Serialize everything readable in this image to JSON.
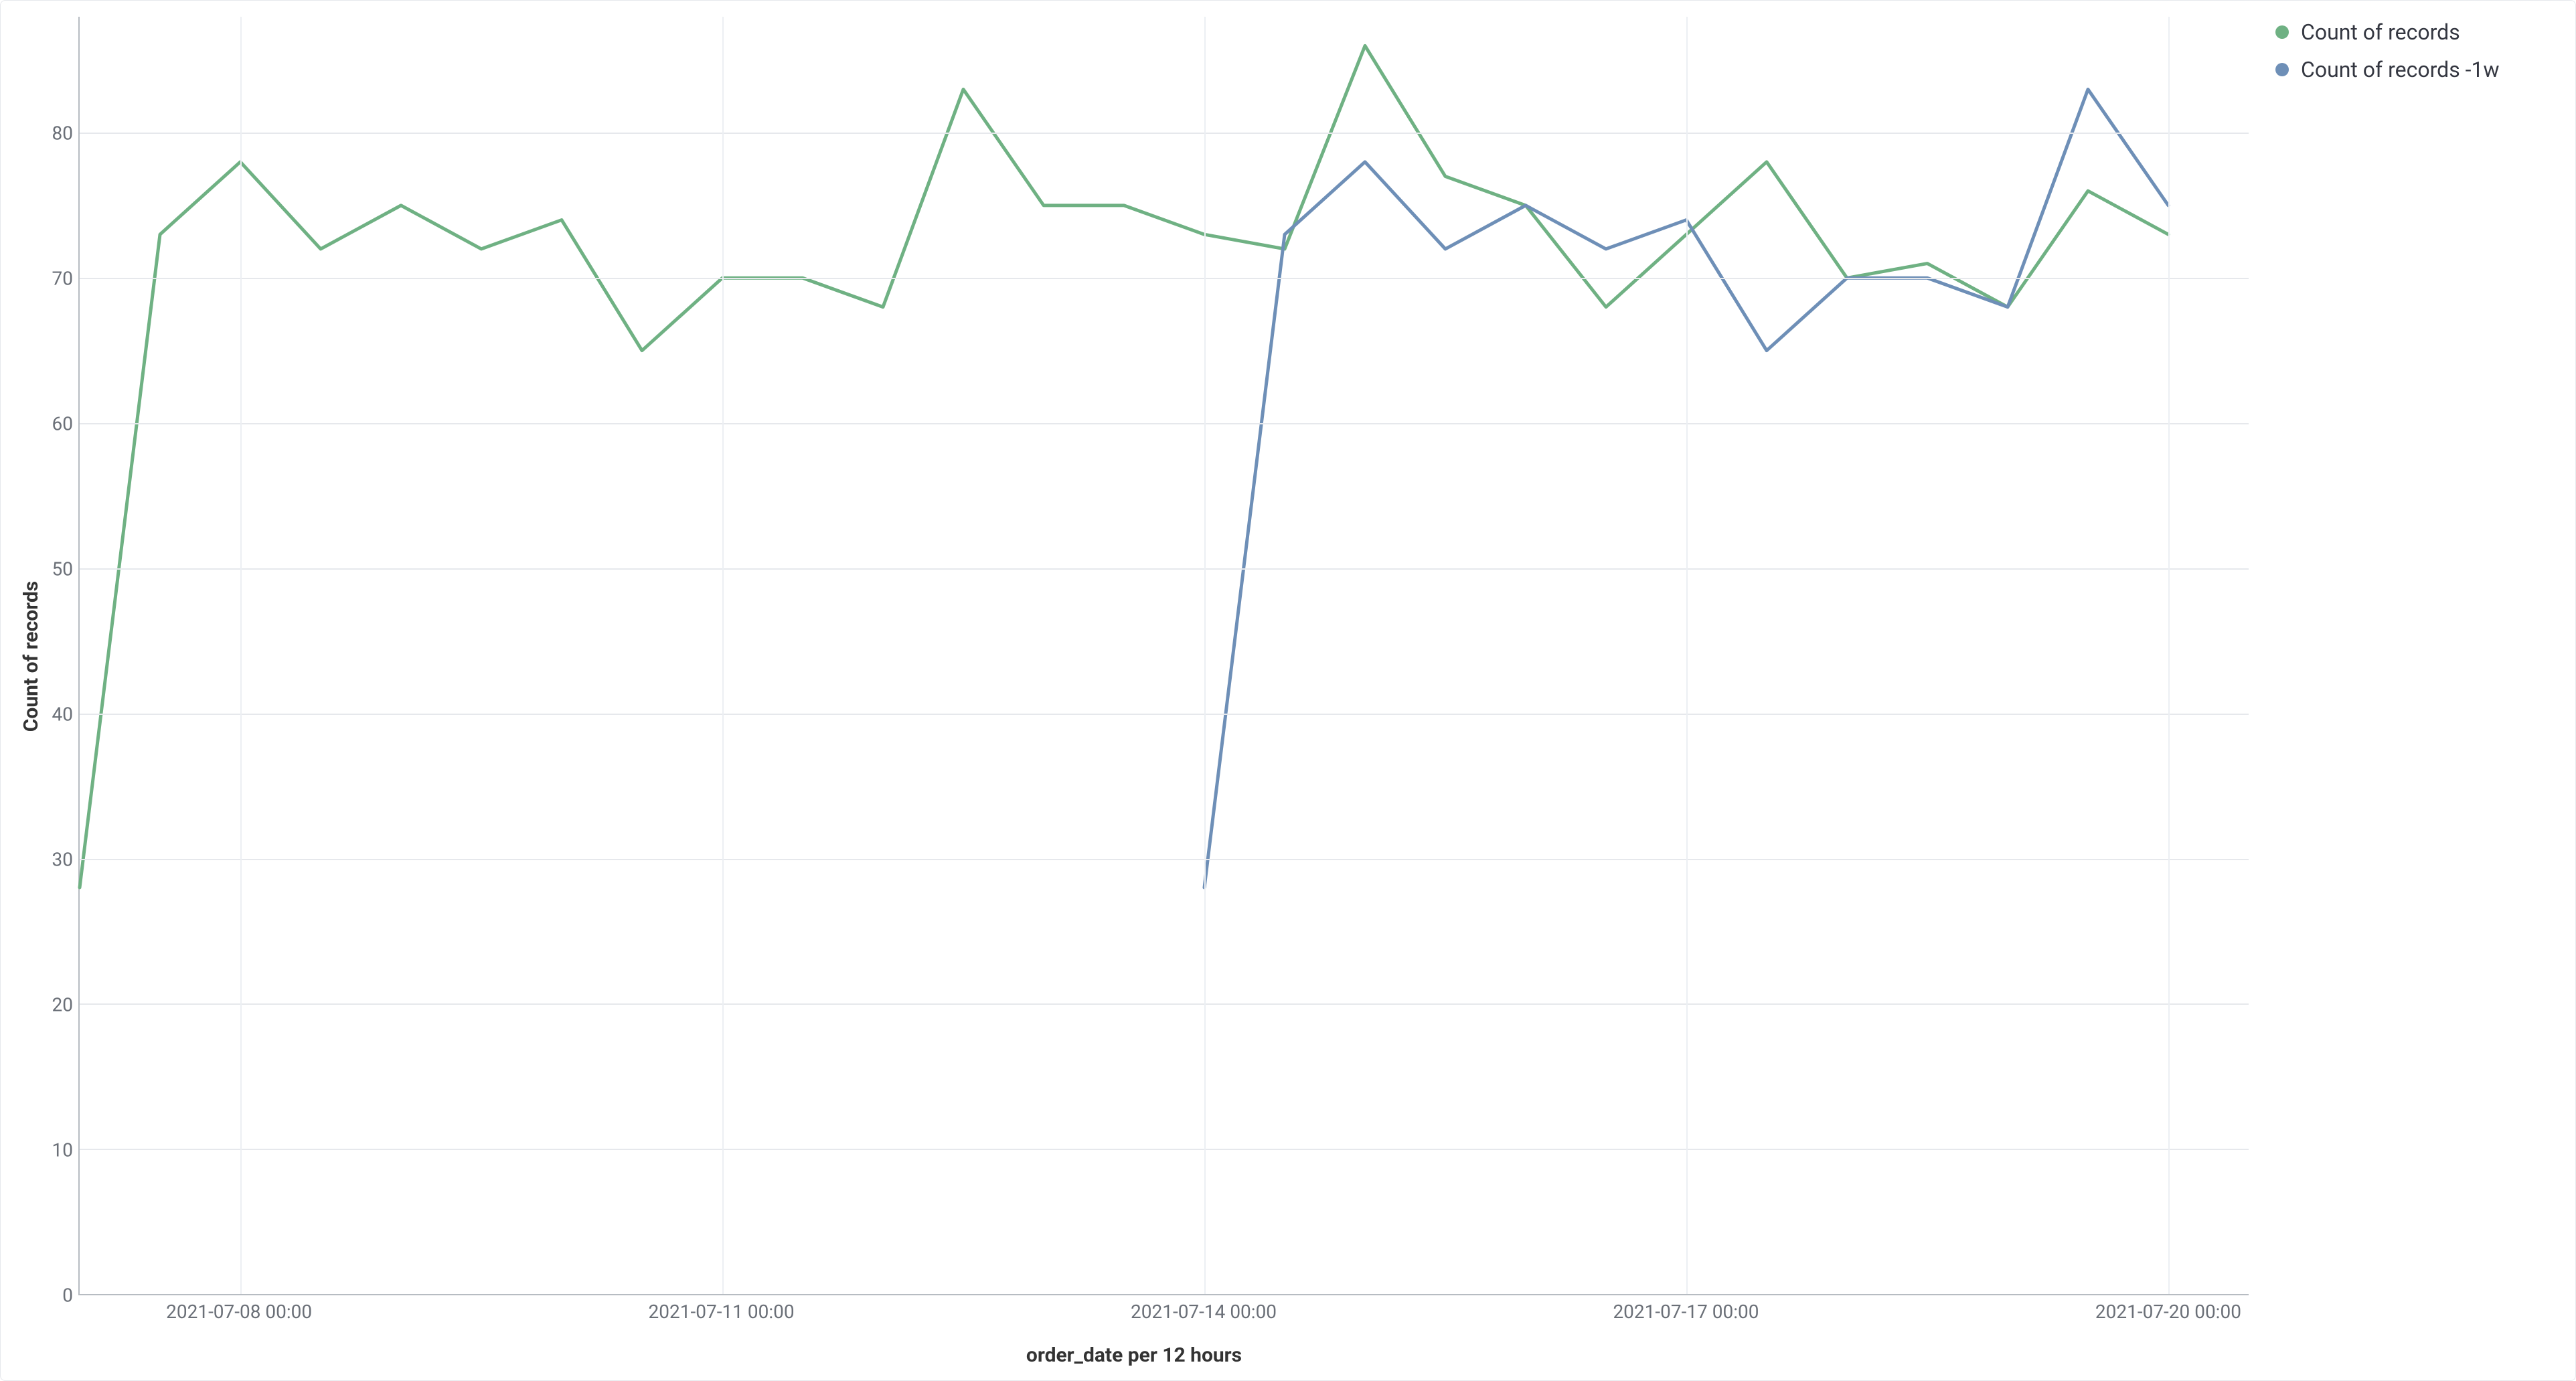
{
  "chart_data": {
    "type": "line",
    "xlabel": "order_date per 12 hours",
    "ylabel": "Count of records",
    "ylim": [
      0,
      88
    ],
    "y_ticks": [
      0,
      10,
      20,
      30,
      40,
      50,
      60,
      70,
      80
    ],
    "x_tick_labels": [
      "2021-07-08 00:00",
      "2021-07-11 00:00",
      "2021-07-14 00:00",
      "2021-07-17 00:00",
      "2021-07-20 00:00"
    ],
    "x_tick_positions": [
      2,
      8,
      14,
      20,
      26
    ],
    "x_start_index": 0,
    "x_end_index": 27,
    "vgrid_indices": [
      2,
      8,
      14,
      20,
      26
    ],
    "series": [
      {
        "name": "Count of records",
        "color": "#6fb183",
        "start_index": 0,
        "values": [
          28,
          73,
          78,
          72,
          75,
          72,
          74,
          65,
          70,
          70,
          68,
          83,
          75,
          75,
          73,
          72,
          86,
          77,
          75,
          68,
          73,
          78,
          70,
          71,
          68,
          76,
          73
        ]
      },
      {
        "name": "Count of records -1w",
        "color": "#6e8fb7",
        "start_index": 14,
        "values": [
          28,
          73,
          78,
          72,
          75,
          72,
          74,
          65,
          70,
          70,
          68,
          83,
          75
        ]
      }
    ]
  },
  "legend": {
    "items": [
      {
        "label": "Count of records",
        "color": "#6fb183"
      },
      {
        "label": "Count of records -1w",
        "color": "#6e8fb7"
      }
    ]
  }
}
